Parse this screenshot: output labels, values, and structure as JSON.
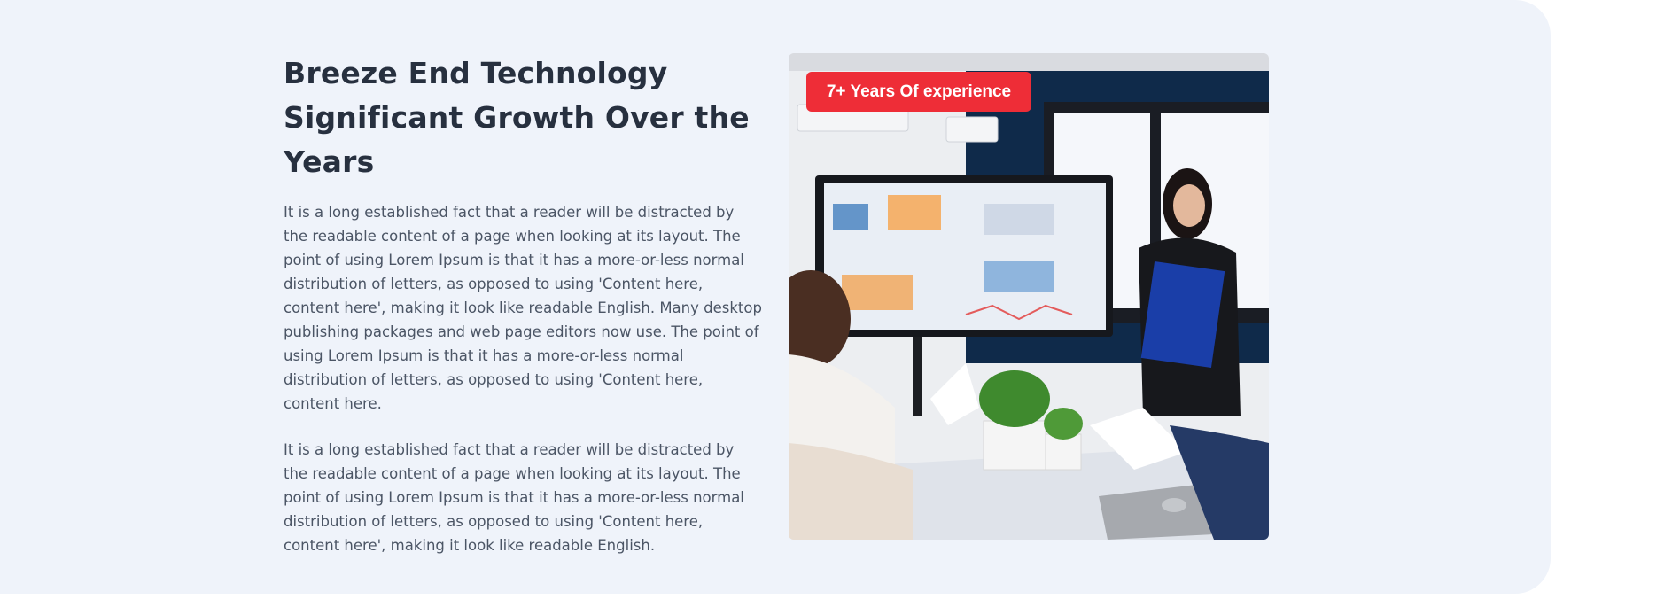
{
  "about": {
    "title": "Breeze End Technology Significant Growth Over the Years",
    "paragraph_1": "It is a long established fact that a reader will be distracted by the readable content of a page when looking at its layout. The point of using Lorem Ipsum is that it has a more-or-less normal distribution of letters, as opposed to using 'Content here, content here', making it look like readable English. Many desktop publishing packages and web page editors now use. The point of using Lorem Ipsum is that it has a more-or-less normal distribution of letters, as opposed to using 'Content here, content here.",
    "paragraph_2": "It is a long established fact that a reader will be distracted by the readable content of a page when looking at its layout. The point of using Lorem Ipsum is that it has a more-or-less normal distribution of letters, as opposed to using 'Content here, content here', making it look like readable English.",
    "badge": "7+ Years Of experience",
    "image": "office-presentation-photo"
  },
  "colors": {
    "section_bg": "#eff3fa",
    "heading": "#27303f",
    "body_text": "#4b5565",
    "badge_bg": "#ee2d37",
    "badge_text": "#ffffff"
  }
}
